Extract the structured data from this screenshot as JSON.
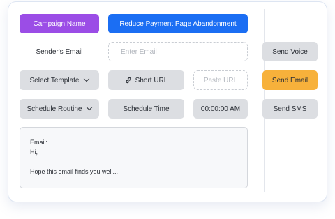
{
  "fields": {
    "campaign_label": "Campaign Name",
    "campaign_value": "Reduce Payment Page Abandonment",
    "sender_label": "Sender's Email",
    "email_placeholder": "Enter Email",
    "select_template": "Select Template",
    "short_url": "Short URL",
    "paste_url_placeholder": "Paste URL",
    "schedule_routine": "Schedule Routine",
    "schedule_time": "Schedule Time",
    "time_value": "00:00:00 AM"
  },
  "actions": {
    "send_voice": "Send Voice",
    "send_email": "Send Email",
    "send_sms": "Send SMS"
  },
  "email_preview": {
    "line1": "Email:",
    "line2": "Hi,",
    "line3": "Hope this email finds you well..."
  },
  "colors": {
    "campaign_label_bg": "#9b4de6",
    "campaign_value_bg": "#1b6ef3",
    "send_email_bg": "#f7b13b",
    "button_gray": "#dcdee2"
  },
  "icons": {
    "short_url": "link-icon",
    "dropdown": "chevron-down-icon"
  }
}
